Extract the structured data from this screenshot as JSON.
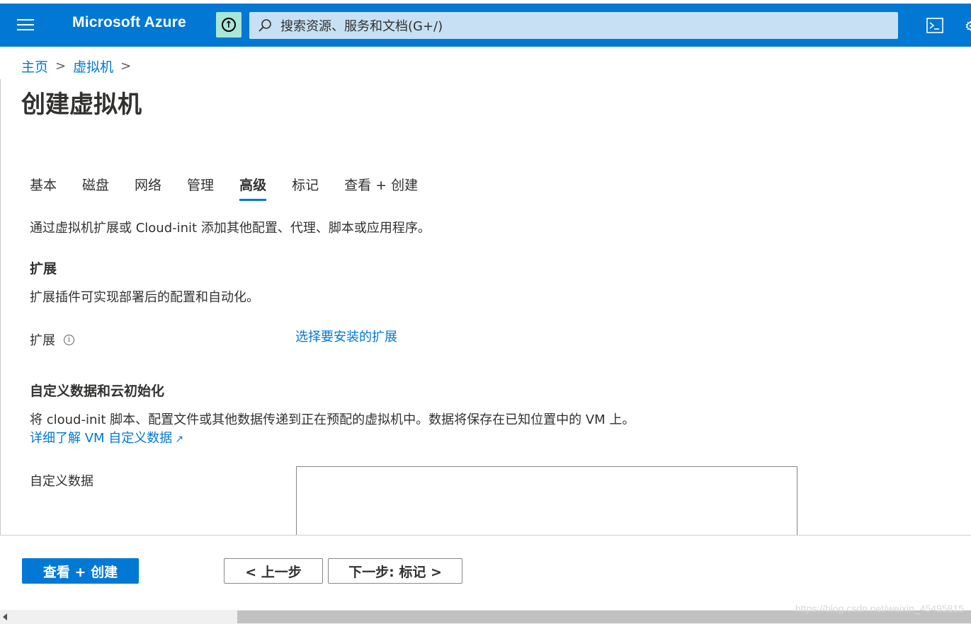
{
  "header": {
    "brand": "Microsoft Azure",
    "search_placeholder": "搜索资源、服务和文档(G+/)",
    "icons": [
      "hamburger-menu-icon",
      "upgrade-arrow-icon",
      "search-icon",
      "cloud-shell-icon",
      "settings-icon"
    ]
  },
  "breadcrumb": {
    "items": [
      "主页",
      "虚拟机"
    ],
    "separator": ">"
  },
  "page_title": "创建虚拟机",
  "tabs": {
    "items": [
      "基本",
      "磁盘",
      "网络",
      "管理",
      "高级",
      "标记",
      "查看 + 创建"
    ],
    "active": "高级"
  },
  "intro": "通过虚拟机扩展或 Cloud-init 添加其他配置、代理、脚本或应用程序。",
  "extensions": {
    "title": "扩展",
    "description": "扩展插件可实现部署后的配置和自动化。",
    "field_label": "扩展",
    "info_glyph": "i",
    "link": "选择要安装的扩展"
  },
  "custom_data": {
    "title": "自定义数据和云初始化",
    "description": "将 cloud-init 脚本、配置文件或其他数据传递到正在预配的虚拟机中。数据将保存在已知位置中的 VM 上。",
    "learn_more": "详细了解 VM 自定义数据",
    "external_glyph": "↗",
    "field_label": "自定义数据",
    "value": ""
  },
  "footer": {
    "review_create": "查看 + 创建",
    "previous": "< 上一步",
    "next": "下一步: 标记 >"
  },
  "watermark": "https://blog.csdn.net/weixin_45495815",
  "colors": {
    "accent": "#0078d4",
    "upgrade_button": "#a8e6d8",
    "search_background": "#c7e0f4"
  }
}
